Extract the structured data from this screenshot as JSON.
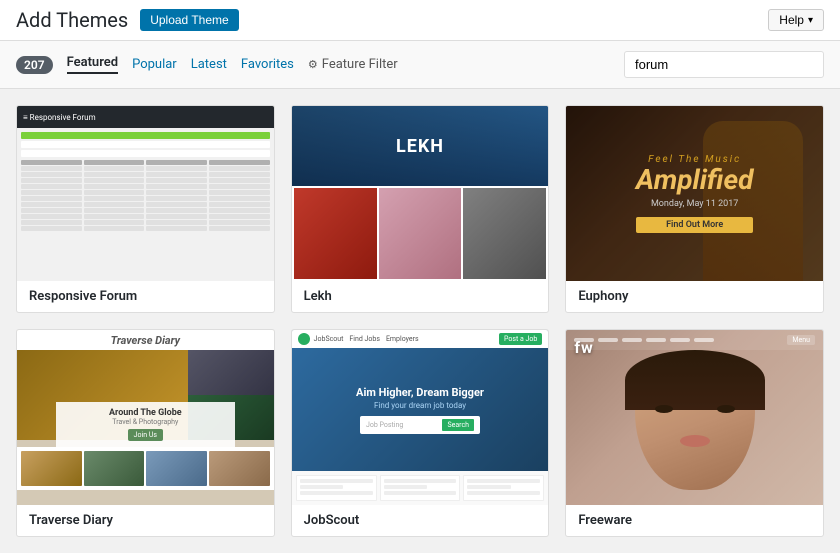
{
  "header": {
    "title": "Add Themes",
    "upload_btn": "Upload Theme",
    "help_btn": "Help"
  },
  "nav": {
    "count": "207",
    "tabs": [
      {
        "id": "featured",
        "label": "Featured",
        "active": true
      },
      {
        "id": "popular",
        "label": "Popular",
        "active": false
      },
      {
        "id": "latest",
        "label": "Latest",
        "active": false
      },
      {
        "id": "favorites",
        "label": "Favorites",
        "active": false
      }
    ],
    "feature_filter": "Feature Filter",
    "search_placeholder": "forum",
    "search_value": "forum"
  },
  "themes": [
    {
      "id": "responsive-forum",
      "name": "Responsive Forum",
      "type": "responsive-forum"
    },
    {
      "id": "lekh",
      "name": "Lekh",
      "type": "lekh"
    },
    {
      "id": "euphony",
      "name": "Euphony",
      "type": "euphony"
    },
    {
      "id": "traverse-diary",
      "name": "Traverse Diary",
      "type": "traverse-diary"
    },
    {
      "id": "jobscout",
      "name": "JobScout",
      "type": "jobscout"
    },
    {
      "id": "freeware",
      "name": "Freeware",
      "type": "freeware"
    }
  ],
  "euphony": {
    "tagline": "Feel The Music",
    "amplified": "Amplified",
    "cta": "Find Out More"
  },
  "lekh": {
    "title": "LEKH"
  },
  "traverse_diary": {
    "card_title": "Around The Globe",
    "card_sub": "Travel & Photography",
    "btn": "Join Us"
  },
  "jobscout": {
    "hero_title": "Aim Higher, Dream Bigger",
    "search_placeholder": "Job Posting"
  }
}
